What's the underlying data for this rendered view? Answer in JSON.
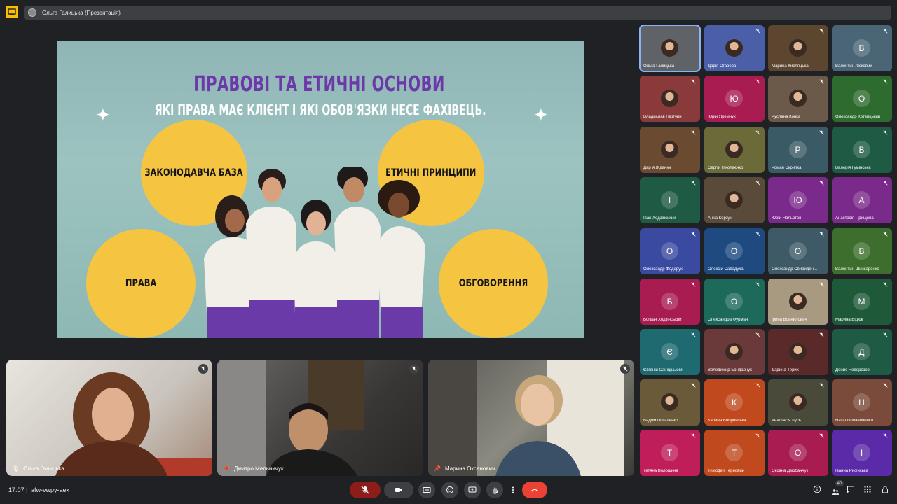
{
  "presenting": {
    "label": "Ольга Галицька (Презентація)"
  },
  "slide": {
    "title": "ПРАВОВІ ТА ЕТИЧНІ ОСНОВИ",
    "subtitle": "ЯКІ ПРАВА МАЄ КЛІЄНТ І ЯКІ ОБОВ'ЯЗКИ НЕСЕ ФАХІВЕЦЬ.",
    "circles": [
      "ЗАКОНОДАВЧА БАЗА",
      "ЕТИЧНІ ПРИНЦИПИ",
      "ПРАВА",
      "ОБГОВОРЕННЯ"
    ]
  },
  "videos": [
    {
      "name": "Ольга Галицька"
    },
    {
      "name": "Дмитро Мельничук"
    },
    {
      "name": "Марина Оксенович"
    }
  ],
  "tiles": [
    {
      "name": "Ольга Галицька",
      "initial": "",
      "color": "#5f6368",
      "photo": true,
      "active": true
    },
    {
      "name": "Дарія Огарева",
      "initial": "",
      "color": "#4a5fa8",
      "photo": true
    },
    {
      "name": "Марина Кисляцька",
      "initial": "",
      "color": "#5c4630",
      "photo": true
    },
    {
      "name": "Валентин Лісковий",
      "initial": "В",
      "color": "#4a6676"
    },
    {
      "name": "Владислав Нікітчин",
      "initial": "",
      "color": "#8a3a3a",
      "photo": true
    },
    {
      "name": "Юрій Яремчук",
      "initial": "Ю",
      "color": "#a81c52"
    },
    {
      "name": "Руслана Конка",
      "initial": "",
      "color": "#6b5a4a",
      "photo": true
    },
    {
      "name": "Олександр Котвицький",
      "initial": "О",
      "color": "#2e6b2e"
    },
    {
      "name": "Дар`я Жданюк",
      "initial": "",
      "color": "#6b4a32",
      "photo": true
    },
    {
      "name": "Сергій Ніколаєнко",
      "initial": "",
      "color": "#6b6b3a",
      "photo": true
    },
    {
      "name": "Роман Скрипка",
      "initial": "Р",
      "color": "#3a5a66"
    },
    {
      "name": "Валерія Гумінська",
      "initial": "В",
      "color": "#1e5a44"
    },
    {
      "name": "Іван Ходзінський",
      "initial": "І",
      "color": "#1e5a44"
    },
    {
      "name": "Анна Корзун",
      "initial": "",
      "color": "#5a4a3a",
      "photo": true
    },
    {
      "name": "Юрій Нальотов",
      "initial": "Ю",
      "color": "#7a2a8a"
    },
    {
      "name": "Анастасія Прищепа",
      "initial": "А",
      "color": "#7a2a8a"
    },
    {
      "name": "Олександр Федорук",
      "initial": "О",
      "color": "#3a4aa0"
    },
    {
      "name": "Олексій Сабадуха",
      "initial": "О",
      "color": "#1e4a80"
    },
    {
      "name": "Олександр Свириден...",
      "initial": "О",
      "color": "#3e5a66"
    },
    {
      "name": "Валентин Шинкаренко",
      "initial": "В",
      "color": "#3e6e2e"
    },
    {
      "name": "Богдан Ходзінський",
      "initial": "Б",
      "color": "#a81c52"
    },
    {
      "name": "Олександра Фурман",
      "initial": "О",
      "color": "#1e6a5a"
    },
    {
      "name": "Ірина Войнилович",
      "initial": "",
      "color": "#a89a80",
      "photo": true
    },
    {
      "name": "Марина Бідюк",
      "initial": "М",
      "color": "#1e5a3a"
    },
    {
      "name": "Євгеній Саінціцький",
      "initial": "Є",
      "color": "#1e6a70"
    },
    {
      "name": "Володимир Бондарчук",
      "initial": "",
      "color": "#6a3a3a",
      "photo": true
    },
    {
      "name": "Дарина Терих",
      "initial": "",
      "color": "#5a2a2a",
      "photo": true
    },
    {
      "name": "Денис Недорезов",
      "initial": "Д",
      "color": "#1e5a44"
    },
    {
      "name": "Вадим Потапенко",
      "initial": "",
      "color": "#6a5a3a",
      "photo": true
    },
    {
      "name": "Карина Бобровська",
      "initial": "К",
      "color": "#c04a1e"
    },
    {
      "name": "Анастасія Лусь",
      "initial": "",
      "color": "#4a4a3a",
      "photo": true
    },
    {
      "name": "Наталія Іваниченко",
      "initial": "Н",
      "color": "#7a4a3a"
    },
    {
      "name": "Тетяна Волошина",
      "initial": "Т",
      "color": "#c01e5a"
    },
    {
      "name": "Тимофій Терновий",
      "initial": "Т",
      "color": "#c04a1e"
    },
    {
      "name": "Оксана Дзюбанчук",
      "initial": "О",
      "color": "#a81c52"
    },
    {
      "name": "Іванна Рисінська",
      "initial": "І",
      "color": "#5a2aa8"
    }
  ],
  "bottombar": {
    "time": "17:07",
    "separator": "|",
    "meeting_code": "afw-vwpy-aek",
    "participant_count": "40"
  }
}
